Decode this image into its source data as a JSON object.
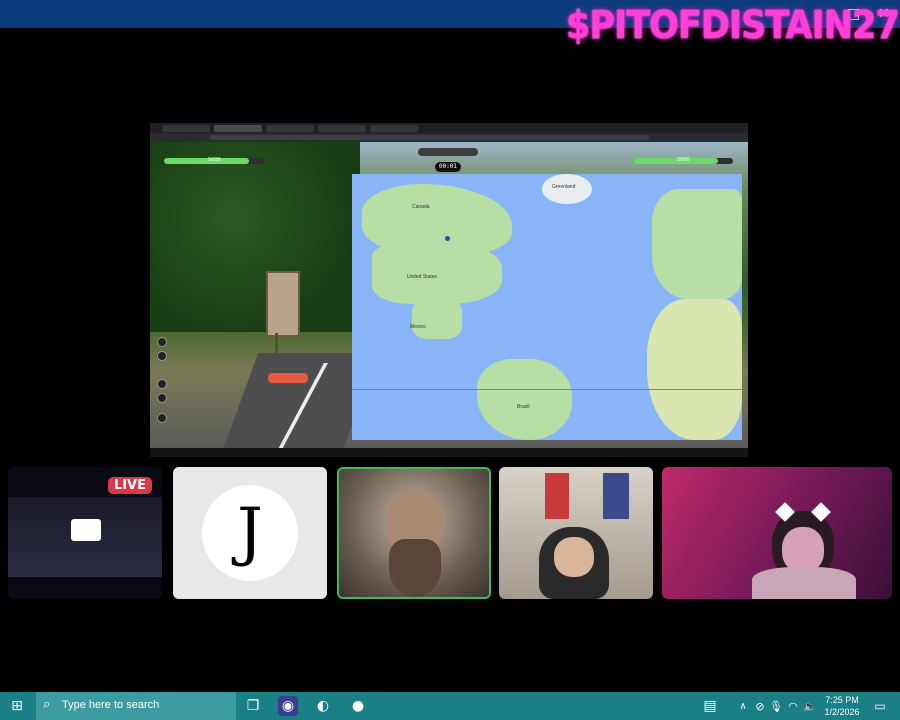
{
  "window": {
    "brand_text": "$PITOFDISTAIN27",
    "controls": [
      "□",
      "✕"
    ]
  },
  "shared_screen": {
    "player_left_score": "5000",
    "player_right_score": "5000",
    "timer": "00:01",
    "map_labels": {
      "canada": "Canada",
      "united_states": "United States",
      "mexico": "Mexico",
      "brazil": "Brazil",
      "greenland": "Greenland"
    },
    "health_fraction_left": 0.85,
    "health_fraction_right": 0.85
  },
  "participants": [
    {
      "name": "stream-tile",
      "live_badge": "LIVE"
    },
    {
      "name": "avatar-tile",
      "avatar_letter": "J"
    },
    {
      "name": "camera-tile-bearded",
      "speaking": true
    },
    {
      "name": "camera-tile-glasses"
    },
    {
      "name": "camera-tile-cat-ears"
    }
  ],
  "taskbar": {
    "search_placeholder": "Type here to search",
    "time": "7:25 PM",
    "date": "1/2/2026",
    "icons": [
      "windows-start-icon",
      "search-icon",
      "task-view-icon",
      "discord-icon",
      "edge-icon",
      "obs-icon",
      "file-icon",
      "chevron-up-icon",
      "network-off-icon",
      "microphone-icon",
      "wifi-icon",
      "volume-icon",
      "notification-icon"
    ]
  },
  "colors": {
    "taskbar": "#1b7f86",
    "live_badge": "#d93a4a",
    "brand": "#ff3fd8",
    "speaking_border": "#3fb95a"
  }
}
